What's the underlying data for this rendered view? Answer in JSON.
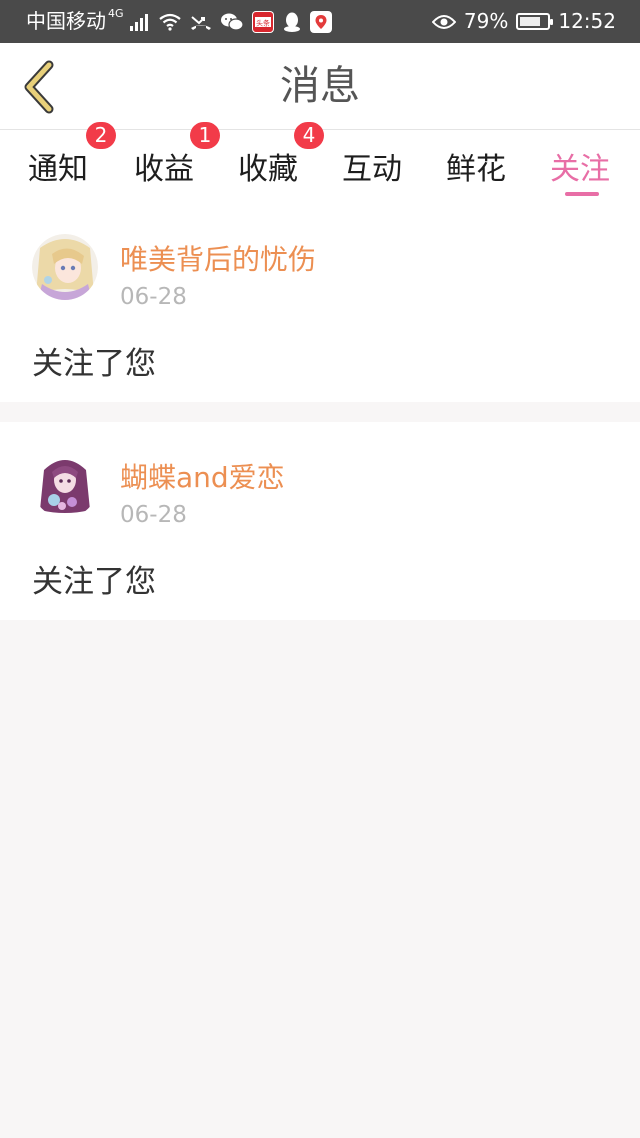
{
  "status_bar": {
    "carrier": "中国移动",
    "network": "4G",
    "battery": "79%",
    "battery_level": 0.79,
    "time": "12:52",
    "icons": [
      "signal-icon",
      "wifi-icon",
      "missed-call-icon",
      "wechat-icon",
      "toutiao-icon",
      "qq-icon",
      "map-pin-app-icon",
      "eye-icon",
      "battery-icon"
    ],
    "toutiao_label": "头条"
  },
  "header": {
    "title": "消息",
    "back_icon": "chevron-left-icon"
  },
  "tabs": [
    {
      "label": "通知",
      "badge": "2",
      "active": false
    },
    {
      "label": "收益",
      "badge": "1",
      "active": false
    },
    {
      "label": "收藏",
      "badge": "4",
      "active": false
    },
    {
      "label": "互动",
      "badge": "",
      "active": false
    },
    {
      "label": "鲜花",
      "badge": "",
      "active": false
    },
    {
      "label": "关注",
      "badge": "",
      "active": true
    }
  ],
  "messages": [
    {
      "username": "唯美背后的忧伤",
      "date": "06-28",
      "text": "关注了您"
    },
    {
      "username": "蝴蝶and爱恋",
      "date": "06-28",
      "text": "关注了您"
    }
  ],
  "colors": {
    "accent": "#e86ea6",
    "username": "#ec8f52",
    "badge": "#f23b49",
    "back_arrow": "#e8d07a",
    "status_bar": "#4a4a4a"
  }
}
